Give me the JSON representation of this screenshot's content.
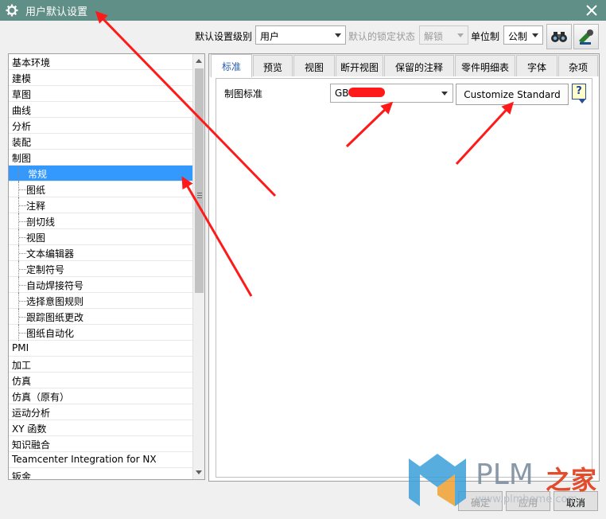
{
  "window": {
    "title": "用户默认设置"
  },
  "toolbar": {
    "level_label": "默认设置级别",
    "level_value": "用户",
    "lock_label": "默认的锁定状态",
    "lock_value": "解锁",
    "unit_label": "单位制",
    "unit_value": "公制",
    "button1_icon": "binoculars-icon",
    "button2_icon": "manage-icon"
  },
  "tree": {
    "items": [
      {
        "label": "基本环境",
        "child": false,
        "selected": false
      },
      {
        "label": "建模",
        "child": false,
        "selected": false
      },
      {
        "label": "草图",
        "child": false,
        "selected": false
      },
      {
        "label": "曲线",
        "child": false,
        "selected": false
      },
      {
        "label": "分析",
        "child": false,
        "selected": false
      },
      {
        "label": "装配",
        "child": false,
        "selected": false
      },
      {
        "label": "制图",
        "child": false,
        "selected": false
      },
      {
        "label": "常规",
        "child": true,
        "selected": true
      },
      {
        "label": "图纸",
        "child": true,
        "selected": false
      },
      {
        "label": "注释",
        "child": true,
        "selected": false
      },
      {
        "label": "剖切线",
        "child": true,
        "selected": false
      },
      {
        "label": "视图",
        "child": true,
        "selected": false
      },
      {
        "label": "文本编辑器",
        "child": true,
        "selected": false
      },
      {
        "label": "定制符号",
        "child": true,
        "selected": false
      },
      {
        "label": "自动焊接符号",
        "child": true,
        "selected": false
      },
      {
        "label": "选择意图规则",
        "child": true,
        "selected": false
      },
      {
        "label": "跟踪图纸更改",
        "child": true,
        "selected": false
      },
      {
        "label": "图纸自动化",
        "child": true,
        "selected": false
      },
      {
        "label": "PMI",
        "child": false,
        "selected": false
      },
      {
        "label": "加工",
        "child": false,
        "selected": false
      },
      {
        "label": "仿真",
        "child": false,
        "selected": false
      },
      {
        "label": "仿真（原有）",
        "child": false,
        "selected": false
      },
      {
        "label": "运动分析",
        "child": false,
        "selected": false
      },
      {
        "label": "XY 函数",
        "child": false,
        "selected": false
      },
      {
        "label": "知识融合",
        "child": false,
        "selected": false
      },
      {
        "label": "Teamcenter Integration for NX",
        "child": false,
        "selected": false
      },
      {
        "label": "钣金",
        "child": false,
        "selected": false
      }
    ]
  },
  "tabs": [
    "标准",
    "预览",
    "视图",
    "断开视图",
    "保留的注释",
    "零件明细表",
    "字体",
    "杂项"
  ],
  "active_tab": 0,
  "main": {
    "field_label": "制图标准",
    "standard_value": "GB",
    "customize_button": "Customize Standard",
    "help_icon": "?"
  },
  "buttons": {
    "apply": "确定",
    "ok": "应用",
    "cancel": "取消"
  },
  "watermark": {
    "text": "PLM",
    "cn": "之家",
    "url": "www.plmhome.com"
  },
  "colors": {
    "titlebar": "#5f8f86",
    "selection": "#3399ff",
    "annotation_arrow": "#ff1a1a"
  }
}
